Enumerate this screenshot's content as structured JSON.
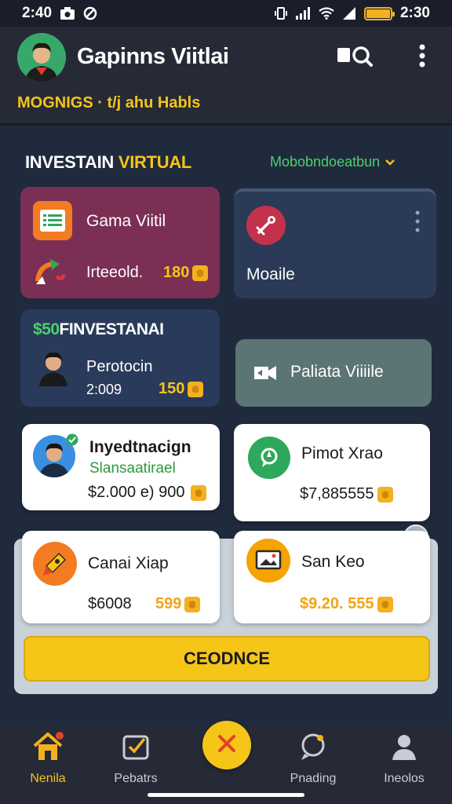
{
  "status_bar": {
    "time_left": "2:40",
    "time_right": "2:30"
  },
  "header": {
    "app_title": "Gapinns Viitlai",
    "ticker": "MOGNIGS · t/j ahu Habls"
  },
  "section": {
    "title_main": "INVESTAIN ",
    "title_accent": "VIRTUAL",
    "filter_label": "Mobobndoeatbun"
  },
  "cards": {
    "gaming": {
      "title": "Gama Viitil",
      "label": "Irteeold.",
      "value": "180"
    },
    "mobile": {
      "title": "Moaile"
    },
    "invest": {
      "heading_prefix": "$50",
      "heading": "FINVESTANAI",
      "name": "Perotocin",
      "sub": "2:009",
      "value": "150"
    },
    "pilot": {
      "title": "Paliata Viiiile"
    }
  },
  "listings": [
    {
      "title": "Inyedtnacign",
      "subtitle": "Slansaatirael",
      "amount": "$2.000 e) 900"
    },
    {
      "title": "Pimot Xrao",
      "amount": "$7,885555"
    },
    {
      "title": "Canai Xiap",
      "amount": "$6008",
      "value": "599"
    },
    {
      "title": "San Keo",
      "amount": "$9.20. 555"
    }
  ],
  "cta": {
    "label": "CEODNCE"
  },
  "bottom_nav": {
    "items": [
      "Nenila",
      "Pebatrs",
      "Pnading",
      "Ineolos"
    ]
  },
  "colors": {
    "accent_yellow": "#f5c518",
    "accent_green": "#4cd06a",
    "gaming_card": "#7c2f55",
    "background": "#1f2a3d"
  }
}
